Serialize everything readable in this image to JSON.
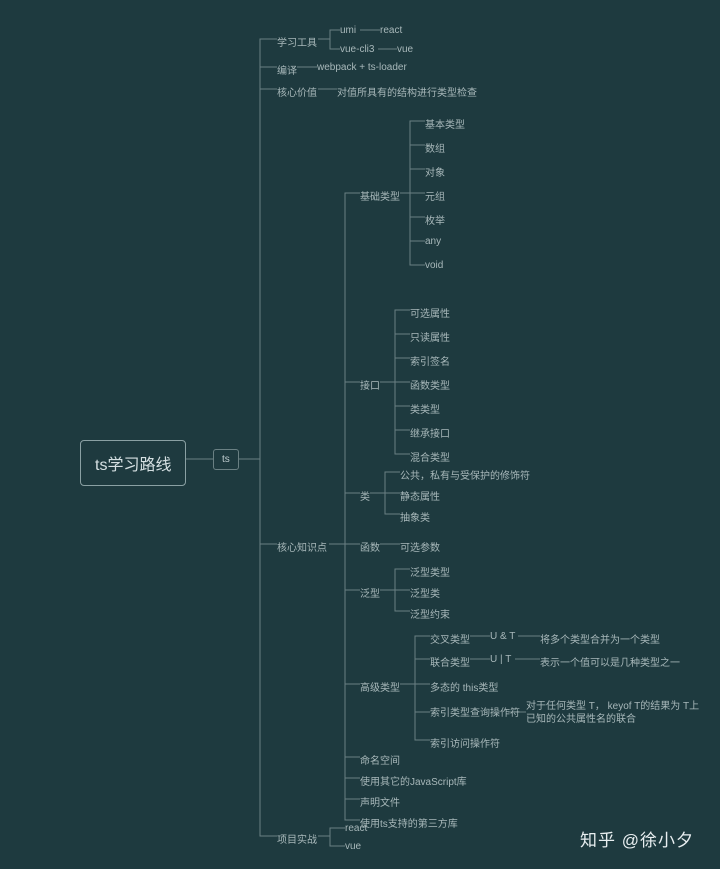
{
  "root": "ts学习路线",
  "sub": "ts",
  "attribution": "知乎 @徐小夕",
  "branches": {
    "study_tools": {
      "label": "学习工具",
      "children": [
        {
          "label": "umi",
          "child": "react"
        },
        {
          "label": "vue-cli3",
          "child": "vue"
        }
      ]
    },
    "compile": {
      "label": "编译",
      "child": "webpack + ts-loader"
    },
    "core_value": {
      "label": "核心价值",
      "child": "对值所具有的结构进行类型检查"
    },
    "core_knowledge": {
      "label": "核心知识点",
      "children": [
        {
          "label": "基础类型",
          "children": [
            "基本类型",
            "数组",
            "对象",
            "元组",
            "枚举",
            "any",
            "void"
          ]
        },
        {
          "label": "接口",
          "children": [
            "可选属性",
            "只读属性",
            "索引签名",
            "函数类型",
            "类类型",
            "继承接口",
            "混合类型"
          ]
        },
        {
          "label": "类",
          "children": [
            "公共，私有与受保护的修饰符",
            "静态属性",
            "抽象类"
          ]
        },
        {
          "label": "函数",
          "children": [
            "可选参数"
          ]
        },
        {
          "label": "泛型",
          "children": [
            "泛型类型",
            "泛型类",
            "泛型约束"
          ]
        },
        {
          "label": "高级类型",
          "children": [
            {
              "label": "交叉类型",
              "sub": "U & T",
              "note": "将多个类型合并为一个类型"
            },
            {
              "label": "联合类型",
              "sub": "U | T",
              "note": "表示一个值可以是几种类型之一"
            },
            {
              "label": "多态的 this类型"
            },
            {
              "label": "索引类型查询操作符",
              "note": "对于任何类型 T， keyof T的结果为 T上已知的公共属性名的联合"
            },
            {
              "label": "索引访问操作符"
            }
          ]
        },
        {
          "label": "命名空间"
        },
        {
          "label": "使用其它的JavaScript库"
        },
        {
          "label": "声明文件"
        },
        {
          "label": "使用ts支持的第三方库"
        }
      ]
    },
    "project": {
      "label": "项目实战",
      "children": [
        "react",
        "vue"
      ]
    }
  }
}
